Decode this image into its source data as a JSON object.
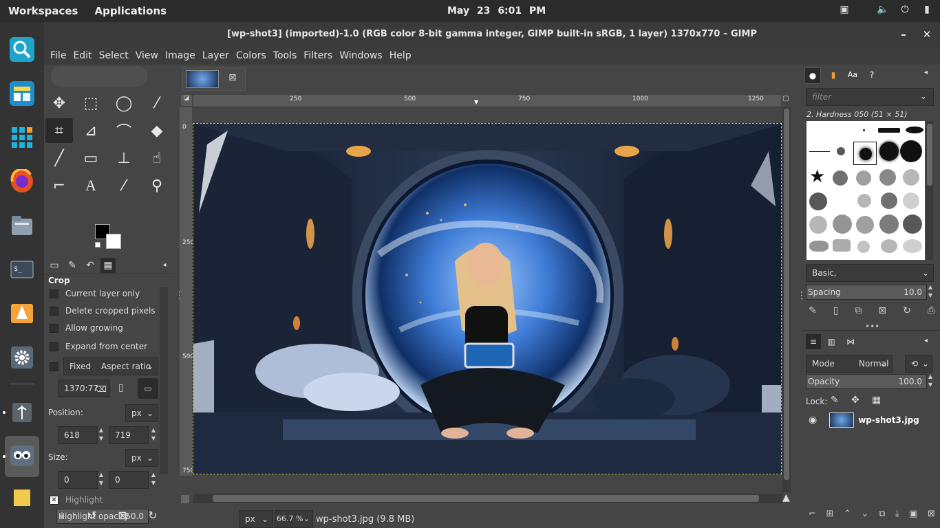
{
  "topbar": {
    "workspaces": "Workspaces",
    "applications": "Applications",
    "date": "May 23",
    "time": "6:01 PM"
  },
  "dock": {
    "items": [
      "magnifier",
      "dashboard",
      "apps-grid",
      "firefox",
      "files",
      "terminal",
      "installer",
      "settings",
      "usb",
      "gimp",
      "notes"
    ]
  },
  "window": {
    "title": "[wp-shot3] (imported)-1.0 (RGB color 8-bit gamma integer, GIMP built-in sRGB, 1 layer) 1370x770 – GIMP",
    "minimize": "–",
    "close": "✕"
  },
  "menu": [
    "File",
    "Edit",
    "Select",
    "View",
    "Image",
    "Layer",
    "Colors",
    "Tools",
    "Filters",
    "Windows",
    "Help"
  ],
  "tool_options": {
    "title": "Crop",
    "current_layer_only": "Current layer only",
    "delete_cropped": "Delete cropped pixels",
    "allow_growing": "Allow growing",
    "expand_center": "Expand from center",
    "fixed": "Fixed",
    "aspect": "Aspect ratio",
    "ratio_value": "1370:77",
    "position_label": "Position:",
    "position_unit": "px",
    "pos_x": "618",
    "pos_y": "719",
    "size_label": "Size:",
    "size_unit": "px",
    "size_w": "0",
    "size_h": "0",
    "highlight": "Highlight",
    "highlight_opacity_label": "Highlight opacity",
    "highlight_opacity": "50.0"
  },
  "ruler": {
    "marks": [
      "250",
      "500",
      "750",
      "1000",
      "1250"
    ],
    "vmarks": [
      "0",
      "250",
      "500",
      "750"
    ]
  },
  "status": {
    "unit": "px",
    "zoom": "66.7 %",
    "file": "wp-shot3.jpg (9.8 MB)"
  },
  "brushes": {
    "filter_placeholder": "filter",
    "current": "2. Hardness 050 (51 × 51)",
    "tag": "Basic,",
    "spacing_label": "Spacing",
    "spacing": "10.0"
  },
  "layers": {
    "mode_label": "Mode",
    "mode": "Normal",
    "opacity_label": "Opacity",
    "opacity": "100.0",
    "lock_label": "Lock:",
    "layer_name": "wp-shot3.jpg"
  },
  "colors": {
    "fg": "#000000",
    "bg": "#ffffff",
    "accent": "#d8c038"
  }
}
